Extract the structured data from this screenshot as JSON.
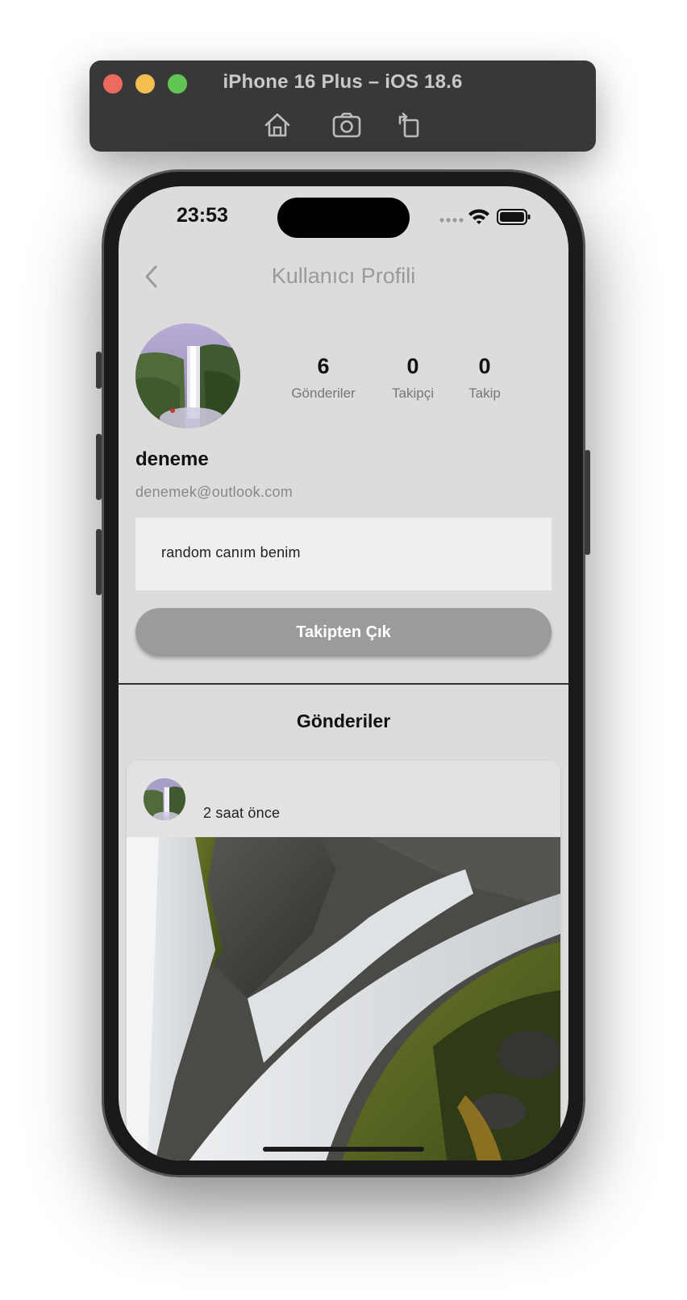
{
  "simulator": {
    "title": "iPhone 16 Plus – iOS 18.6",
    "tools": [
      "home-icon",
      "screenshot-icon",
      "rotate-icon"
    ]
  },
  "status_bar": {
    "time": "23:53"
  },
  "nav": {
    "title": "Kullanıcı Profili"
  },
  "profile": {
    "stats": [
      {
        "value": "6",
        "label": "Gönderiler"
      },
      {
        "value": "0",
        "label": "Takipçi"
      },
      {
        "value": "0",
        "label": "Takip"
      }
    ],
    "username": "deneme",
    "email": "denemek@outlook.com",
    "bio": "random canım benim",
    "unfollow_label": "Takipten Çık"
  },
  "posts": {
    "title": "Gönderiler",
    "items": [
      {
        "time": "2 saat önce"
      }
    ]
  },
  "colors": {
    "screen_bg": "#dcdcdc",
    "button_bg": "#9b9b9b",
    "bio_bg": "#efefef"
  }
}
